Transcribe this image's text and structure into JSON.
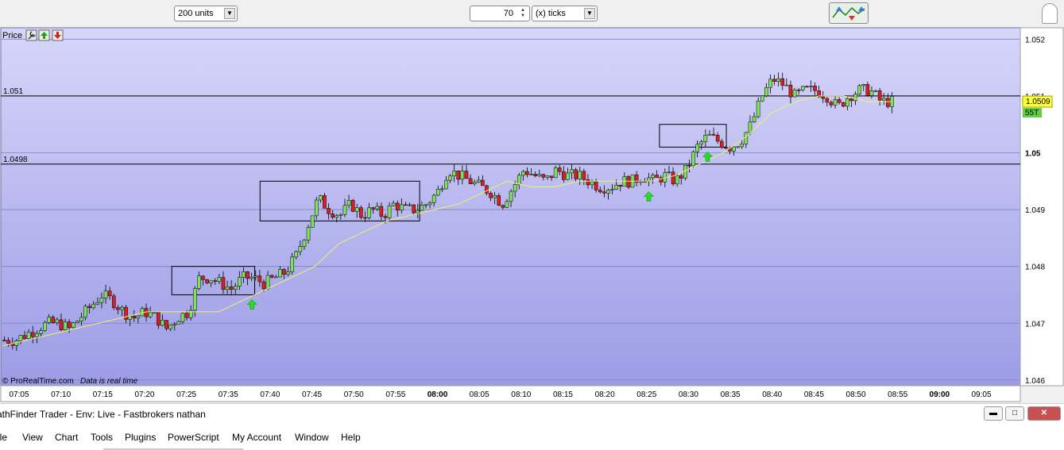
{
  "toolbar": {
    "units_value": "200 units",
    "ticks_value": "70",
    "ticks_unit": "(x) ticks"
  },
  "chart_panel": {
    "label": "Price",
    "watermark": "© ProRealTime.com",
    "realtime_note": "Data is real time",
    "line1_label": "1.051",
    "line2_label": "1.0498",
    "current_price": "1.0509",
    "tick_label": "55T",
    "colors": {
      "background_top": "#d6d6fa",
      "background_bottom": "#9c9ce6",
      "up": "#80e060",
      "down": "#d82020",
      "ma": "#f0f070",
      "signal": "#20e020",
      "price_badge": "#ffff40"
    }
  },
  "chart_data": {
    "type": "candlestick",
    "y_ticks": [
      "1.046",
      "1.047",
      "1.048",
      "1.049",
      "1.05",
      "1.051"
    ],
    "y_tick_top": "1.052",
    "ylim": [
      1.0459,
      1.0522
    ],
    "x_ticks": [
      "07:05",
      "07:10",
      "07:15",
      "07:20",
      "07:25",
      "07:35",
      "07:40",
      "07:45",
      "07:50",
      "07:55",
      "08:00",
      "08:05",
      "08:10",
      "08:15",
      "08:20",
      "08:25",
      "08:30",
      "08:35",
      "08:40",
      "08:45",
      "08:50",
      "08:55",
      "09:00",
      "09:05"
    ],
    "x_ticks_bold": [
      "08:00",
      "09:00"
    ],
    "horizontal_lines": [
      1.051,
      1.0498
    ],
    "last_price": 1.0509,
    "close_path": [
      1.0467,
      1.0467,
      1.0468,
      1.0469,
      1.047,
      1.047,
      1.0469,
      1.0471,
      1.0473,
      1.0475,
      1.0474,
      1.0472,
      1.0471,
      1.0472,
      1.0471,
      1.0469,
      1.0471,
      1.0472,
      1.0478,
      1.0478,
      1.0477,
      1.0476,
      1.0478,
      1.0478,
      1.0477,
      1.0478,
      1.0479,
      1.0482,
      1.0487,
      1.0492,
      1.049,
      1.0489,
      1.0491,
      1.0489,
      1.049,
      1.0489,
      1.0491,
      1.049,
      1.049,
      1.0491,
      1.0493,
      1.0497,
      1.0496,
      1.0495,
      1.0494,
      1.0493,
      1.0491,
      1.0494,
      1.0497,
      1.0496,
      1.0495,
      1.0497,
      1.0496,
      1.0496,
      1.0495,
      1.0494,
      1.0494,
      1.0495,
      1.0495,
      1.0496,
      1.0495,
      1.0496,
      1.0495,
      1.0497,
      1.0501,
      1.0503,
      1.0502,
      1.0501,
      1.0502,
      1.0505,
      1.051,
      1.0513,
      1.0512,
      1.051,
      1.0511,
      1.0511,
      1.051,
      1.0508,
      1.051,
      1.0511,
      1.0511,
      1.0509,
      1.0509
    ],
    "ma_path": [
      1.0466,
      1.0467,
      1.0468,
      1.0469,
      1.047,
      1.0471,
      1.0472,
      1.0472,
      1.0472,
      1.0472,
      1.0474,
      1.0476,
      1.0478,
      1.048,
      1.0484,
      1.0486,
      1.0488,
      1.0489,
      1.049,
      1.0491,
      1.0493,
      1.0495,
      1.0494,
      1.0494,
      1.0495,
      1.0495,
      1.0495,
      1.0495,
      1.0496,
      1.0498,
      1.05,
      1.0503,
      1.0507,
      1.0509,
      1.051,
      1.051,
      1.0509,
      1.0509
    ],
    "consolidation_boxes": [
      {
        "t": [
          0.19,
          0.283
        ],
        "price": [
          1.0475,
          1.048
        ]
      },
      {
        "t": [
          0.289,
          0.468
        ],
        "price": [
          1.0488,
          1.0495
        ]
      },
      {
        "t": [
          0.737,
          0.812
        ],
        "price": [
          1.0501,
          1.0505
        ]
      }
    ],
    "buy_signals": [
      {
        "t": 0.28,
        "price": 1.0475
      },
      {
        "t": 0.725,
        "price": 1.0494
      },
      {
        "t": 0.791,
        "price": 1.0501
      }
    ]
  },
  "titlebar": {
    "title": "athFinder Trader - Env: Live - Fastbrokers nathan",
    "min": "▬",
    "max": "□",
    "close": "✕"
  },
  "menu": [
    "ile",
    "View",
    "Chart",
    "Tools",
    "Plugins",
    "PowerScript",
    "My Account",
    "Window",
    "Help"
  ]
}
